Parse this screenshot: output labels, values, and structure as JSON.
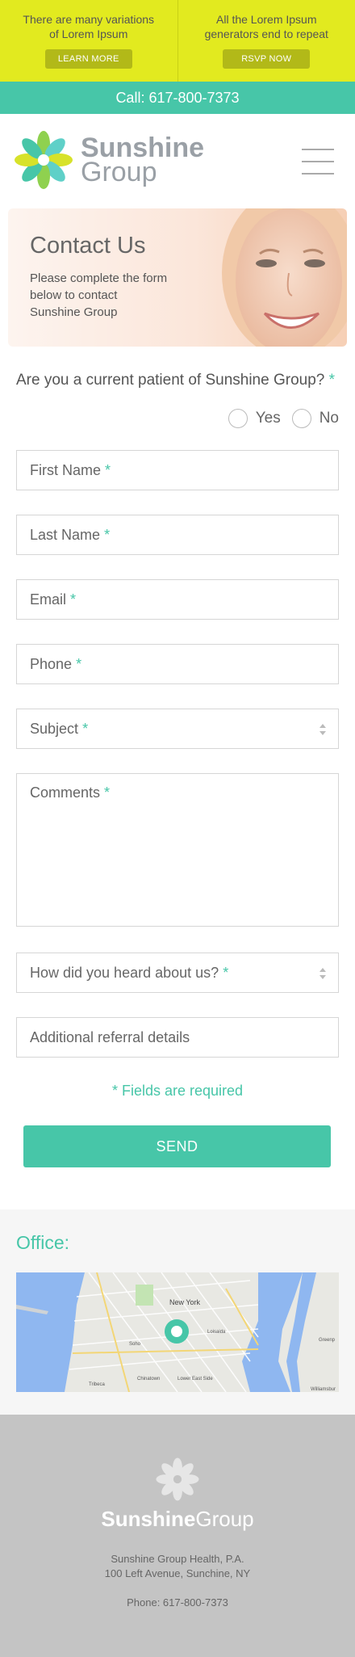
{
  "promo": {
    "left_text": "There are many variations of Lorem Ipsum",
    "left_button": "LEARN MORE",
    "right_text": "All the Lorem Ipsum generators end to repeat",
    "right_button": "RSVP NOW"
  },
  "callbar": {
    "text": "Call: 617-800-7373"
  },
  "header": {
    "logo_line1": "Sunshine",
    "logo_line2": "Group"
  },
  "hero": {
    "title": "Contact Us",
    "subtitle": "Please complete the form below to contact Sunshine Group"
  },
  "form": {
    "question": "Are you a current patient of Sunshine Group?",
    "required_mark": "*",
    "radio_yes": "Yes",
    "radio_no": "No",
    "first_name": "First Name",
    "last_name": "Last Name",
    "email": "Email",
    "phone": "Phone",
    "subject": "Subject",
    "comments": "Comments",
    "heard": "How did you heard about us?",
    "referral": "Additional referral details",
    "required_note": "* Fields are required",
    "send": "SEND"
  },
  "office": {
    "title": "Office:",
    "map_labels": {
      "newyork": "New York",
      "soho": "Soho",
      "chinatown": "Chinatown",
      "tribeca": "Tribeca",
      "les": "Lower East Side",
      "loisaida": "Loisaida",
      "greenpoint": "Greenp",
      "williamsburg": "Williamsbur"
    }
  },
  "footer": {
    "logo_bold": "Sunshine",
    "logo_light": "Group",
    "company": "Sunshine Group Health, P.A.",
    "address": "100 Left Avenue, Sunchine, NY",
    "phone": "Phone: 617-800-7373"
  },
  "colors": {
    "accent": "#47c6a8",
    "promo_bg": "#e2ea1f",
    "promo_button": "#b2b918",
    "footer_bg": "#c4c4c4"
  }
}
